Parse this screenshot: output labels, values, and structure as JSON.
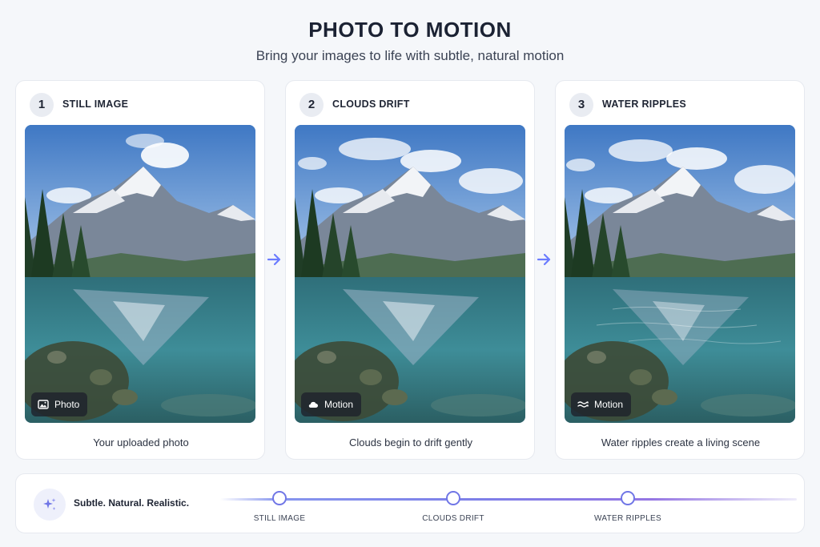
{
  "header": {
    "title": "PHOTO TO MOTION",
    "subtitle": "Bring your images to life with subtle, natural motion"
  },
  "steps": [
    {
      "number": "1",
      "title": "STILL IMAGE",
      "badge_icon": "image-icon",
      "badge_label": "Photo",
      "caption": "Your uploaded photo"
    },
    {
      "number": "2",
      "title": "CLOUDS DRIFT",
      "badge_icon": "cloud-icon",
      "badge_label": "Motion",
      "caption": "Clouds begin to drift gently"
    },
    {
      "number": "3",
      "title": "WATER RIPPLES",
      "badge_icon": "waves-icon",
      "badge_label": "Motion",
      "caption": "Water ripples create a living scene"
    }
  ],
  "footer": {
    "icon": "sparkle-icon",
    "tagline": "Subtle. Natural. Realistic.",
    "timeline": [
      "STILL IMAGE",
      "CLOUDS DRIFT",
      "WATER RIPPLES"
    ]
  },
  "colors": {
    "accent": "#6b7cff",
    "background": "#f5f7fa",
    "card": "#ffffff",
    "badge": "#1e222c"
  }
}
